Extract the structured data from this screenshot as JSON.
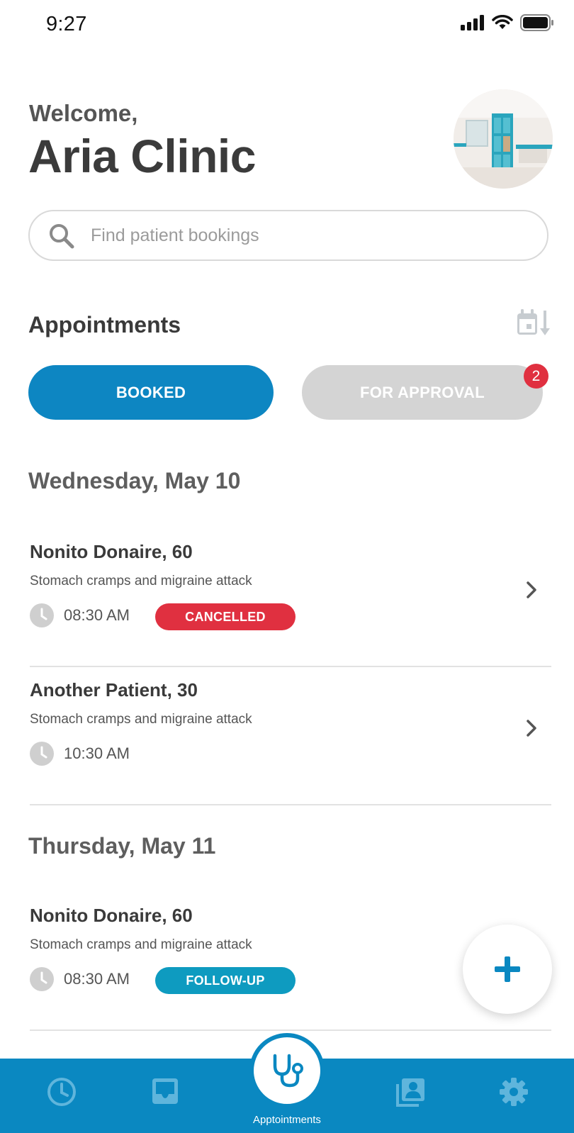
{
  "status_bar": {
    "time": "9:27"
  },
  "header": {
    "welcome": "Welcome,",
    "clinic_name": "Aria Clinic"
  },
  "search": {
    "placeholder": "Find patient bookings",
    "value": ""
  },
  "appointments": {
    "title": "Appointments",
    "tabs": {
      "booked": "BOOKED",
      "for_approval": "FOR APPROVAL",
      "for_approval_count": "2"
    }
  },
  "days": [
    {
      "heading": "Wednesday, May 10",
      "items": [
        {
          "patient": "Nonito Donaire, 60",
          "reason": "Stomach cramps and migraine attack",
          "time": "08:30 AM",
          "tag": "CANCELLED"
        },
        {
          "patient": "Another Patient, 30",
          "reason": "Stomach cramps and migraine attack",
          "time": "10:30 AM",
          "tag": ""
        }
      ]
    },
    {
      "heading": "Thursday, May 11",
      "items": [
        {
          "patient": "Nonito Donaire, 60",
          "reason": "Stomach cramps and migraine attack",
          "time": "08:30 AM",
          "tag": "FOLLOW-UP"
        }
      ]
    }
  ],
  "bottom_nav": {
    "items": [
      "history-icon",
      "inbox-icon",
      "stethoscope-icon",
      "patients-icon",
      "gear-icon"
    ],
    "active_label": "Apptointments"
  },
  "colors": {
    "primary": "#0a88c1",
    "cancelled": "#e03040",
    "follow_up": "#0e9bc0",
    "inactive": "#d4d4d4"
  }
}
